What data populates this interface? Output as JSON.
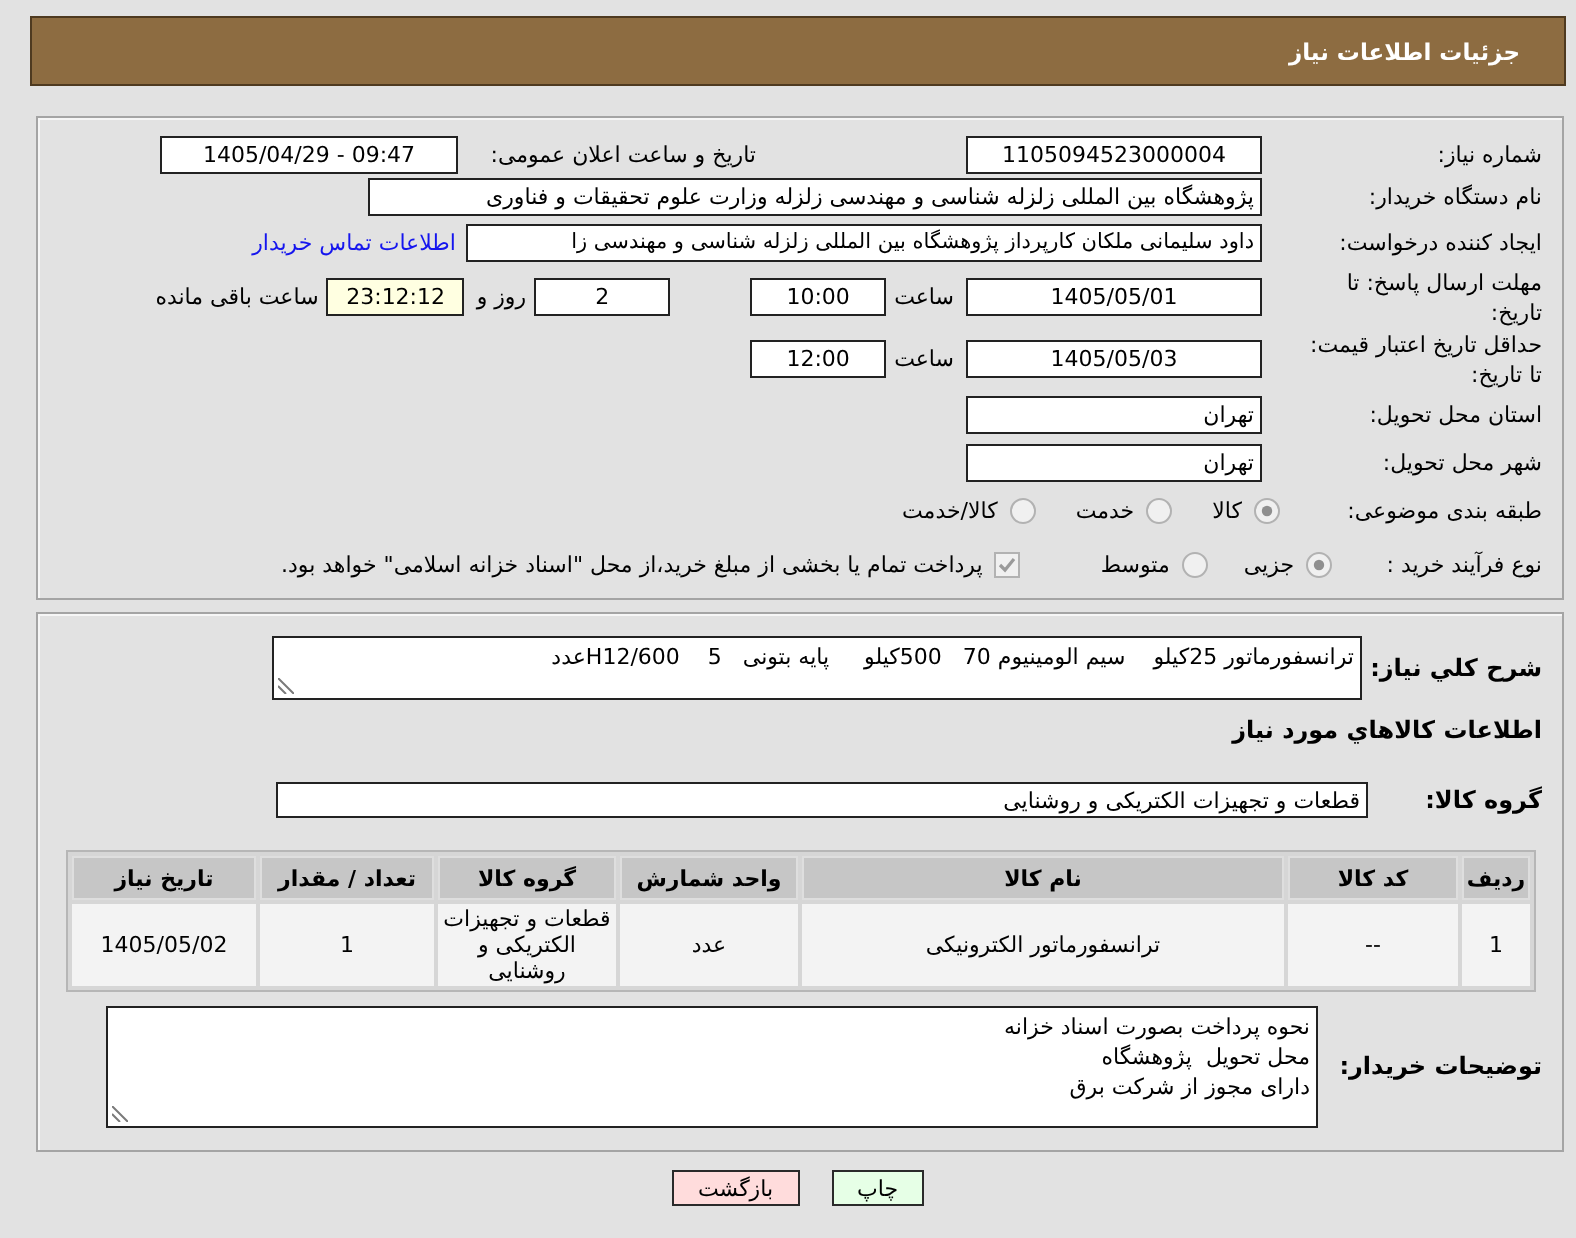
{
  "header": {
    "title": "جزئیات اطلاعات نیاز"
  },
  "details": {
    "need_number": {
      "label": "شماره نیاز:",
      "value": "1105094523000004"
    },
    "announcement": {
      "label": "تاریخ و ساعت اعلان عمومی:",
      "value": "1405/04/29 - 09:47"
    },
    "buyer_organization": {
      "label": "نام دستگاه خریدار:",
      "value": "پژوهشگاه بین المللی زلزله شناسی و مهندسی زلزله وزارت علوم تحقیقات و فناوری"
    },
    "requester": {
      "label": "ایجاد کننده درخواست:",
      "value": "داود سلیمانی ملکان کارپرداز پژوهشگاه بین المللی زلزله شناسی و مهندسی زا",
      "contact_link": "اطلاعات تماس خریدار"
    },
    "response_deadline": {
      "label": "مهلت ارسال پاسخ: تا تاریخ:",
      "date": "1405/05/01",
      "time_label": "ساعت",
      "time": "10:00",
      "days": "2",
      "days_label": "روز و",
      "remaining_time": "23:12:12",
      "remaining_label": "ساعت باقی مانده"
    },
    "price_validity": {
      "label": "حداقل تاریخ اعتبار قیمت: تا تاریخ:",
      "date": "1405/05/03",
      "time_label": "ساعت",
      "time": "12:00"
    },
    "delivery_province": {
      "label": "استان محل تحویل:",
      "value": "تهران"
    },
    "delivery_city": {
      "label": "شهر محل تحویل:",
      "value": "تهران"
    },
    "subject_category": {
      "label": "طبقه بندی موضوعی:",
      "options": [
        {
          "label": "کالا",
          "selected": true
        },
        {
          "label": "خدمت",
          "selected": false
        },
        {
          "label": "کالا/خدمت",
          "selected": false
        }
      ]
    },
    "purchase_process": {
      "label": "نوع فرآیند خرید :",
      "options": [
        {
          "label": "جزیی",
          "selected": true
        },
        {
          "label": "متوسط",
          "selected": false
        }
      ],
      "treasury_payment": {
        "label": "پرداخت تمام یا بخشی از مبلغ خرید،از محل \"اسناد خزانه اسلامی\" خواهد بود.",
        "checked": true
      }
    }
  },
  "description": {
    "label": "شرح كلي نياز:",
    "value": "ترانسفورماتور 25کیلو    سیم الومینیوم 70   500کیلو     پایه بتونی   5    H12/600عدد"
  },
  "goods": {
    "heading": "اطلاعات كالاهاي مورد نياز",
    "group": {
      "label": "گروه کالا:",
      "value": "قطعات و تجهیزات الکتریکی و روشنایی"
    },
    "table": {
      "columns": [
        "ردیف",
        "کد کالا",
        "نام کالا",
        "واحد شمارش",
        "گروه کالا",
        "تعداد / مقدار",
        "تاریخ نیاز"
      ],
      "rows": [
        [
          "1",
          "--",
          "ترانسفورماتور الکترونیکی",
          "عدد",
          "قطعات و تجهیزات الکتریکی و روشنایی",
          "1",
          "1405/05/02"
        ]
      ]
    }
  },
  "buyer_notes": {
    "label": "توضیحات خریدار:",
    "value": "نحوه پرداخت بصورت اسناد خزانه\nمحل تحویل  پژوهشگاه\nدارای مجوز از شرکت برق"
  },
  "buttons": [
    {
      "kind": "print",
      "label": "چاپ"
    },
    {
      "kind": "back",
      "label": "بازگشت"
    }
  ]
}
